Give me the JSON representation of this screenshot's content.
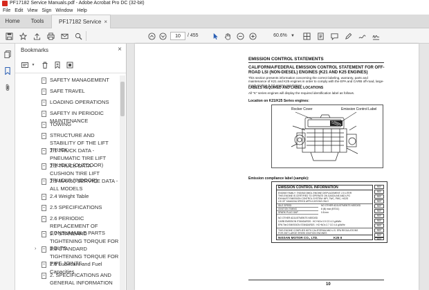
{
  "window": {
    "title": "PF17182 Service Manuals.pdf - Adobe Acrobat Pro DC (32-bit)"
  },
  "menu": [
    "File",
    "Edit",
    "View",
    "Sign",
    "Window",
    "Help"
  ],
  "tabs": {
    "home": "Home",
    "tools": "Tools",
    "document": "PF17182 Service M...",
    "close": "×"
  },
  "toolbar": {
    "current_page": "10",
    "total_pages": "/ 455",
    "zoom": "60.6%",
    "zoom_arrow": "▼"
  },
  "panel": {
    "title": "Bookmarks",
    "close": "×"
  },
  "bookmarks": [
    {
      "label": "SAFETY MANAGEMENT"
    },
    {
      "label": "SAFE TRAVEL"
    },
    {
      "label": "LOADING OPERATIONS"
    },
    {
      "label": "SAFETY IN PERIODIC MAINTENANCE"
    },
    {
      "label": "TOWING"
    },
    {
      "label": "STRUCTURE AND STABILITY OF THE LIFT TRUCK"
    },
    {
      "label": "2.1 TRUCK DATA - PNEUMATIC TIRE LIFT TRUCKS (OUTDOOR)"
    },
    {
      "label": "2.2 TRUCK DATA - CUSHION TIRE LIFT TRUCKS (INDOOR)"
    },
    {
      "label": "2.3 MAX50 SERVICE DATA - ALL MODELS"
    },
    {
      "label": "2.4 Weight Table"
    },
    {
      "label": "2.5 SPECIFICATIONS"
    },
    {
      "label": "2.6 PERIODIC REPLACEMENT OF CONSUMABLE PARTS"
    },
    {
      "label": "2.7 STANDARD TIGHTENING TORQUE FOR BOLTS"
    },
    {
      "label": "2.8 STANDARD TIGHTENING TORQUE FOR PIPE JOINTS",
      "expand": "›"
    },
    {
      "label": "2.9 Lubricant and Fuel Capacities"
    },
    {
      "label": "2. SPECIFICATIONS AND GENERAL INFORMATION"
    }
  ],
  "document": {
    "section_title": "EMISSION CONTROL STATEMENTS",
    "cert_title": "CALIFORNIA/FEDERAL EMISSION CONTROL STATEMENT FOR OFF-ROAD LSI (NON-DIESEL) ENGINES (K21 AND K25 ENGINES)",
    "intro": "This section presents information concerning the correct labeling, warranty, parts and maintenance of K21 and K25 engines in order to comply with the EPA and CARB off-road, large-spark-ignition (LSI) engine regulations.",
    "labels_head": "LABELS REQUIRED AND LABEL LOCATIONS",
    "labels_text": "All \"K\" series engines will display the required identification label as follows.",
    "location_head": "Location on K21/K25 Series engines:",
    "callout_rocker": "Rocker Cover",
    "callout_label": "Emission Control Label",
    "compliance_head": "Emission compliance label (sample):",
    "label_title": "EMISSION CONTROL INFORMATION",
    "label_lines": [
      "ENGINE FAMILY: 7NSXM2.5MGL  ENGINE DISPLACEMENT: 2.5 LITER",
      "THIS ENGINE IS CERTIFIED TO OPERATE ON GASOLINE AND LPG",
      "EXHAUST EMISSION CONTROL SYSTEM: MPI, TWC, PWC, HO2S",
      "LSI OF YAMASHA SPEED APPLICATIONS ONLY"
    ],
    "label_grid": [
      "IDLE SPEED",
      "IGNITION TIMING",
      "SPARK PLUG GAP"
    ],
    "label_grid_values": [
      "NO OTHER ADJUSTMENTS NEEDED",
      "8 (B) max (BTDC)",
      "0.8 mm"
    ],
    "label_lines2": [
      "NO OTHER ADJUSTMENTS NEEDED",
      "CARB EMISSION STANDARDS : HC+NOx 0.9 CO 4.3 g/kWhr",
      "EPA Tier2 EMISSION STANDARDS : HC+NOx 2.7 CO 4.4 g/kWhr"
    ],
    "label_lines3": [
      "THIS ENGINE COMPLIES WITH CALIFORNIA AND U.S. EPA REGULATIONS",
      "FOR 2007 LARGE SPARK IGNITION ENGINES"
    ],
    "label_footer": "NISSAN MOTOR CO., LTD.",
    "label_code": "K25 II",
    "refs": [
      "REF",
      "REF",
      "REF",
      "REF",
      "REF",
      "REF",
      "REF",
      "REF",
      "REF",
      "REF",
      "REF",
      "REF"
    ],
    "page_number": "10"
  },
  "colors": {
    "accent": "#2b5fb4",
    "app_icon": "#d6281c"
  }
}
